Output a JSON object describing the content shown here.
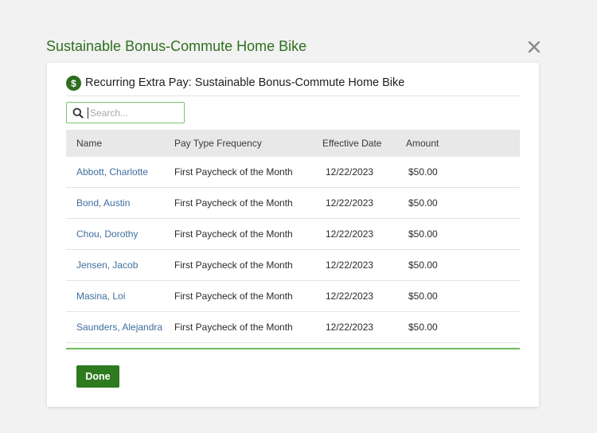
{
  "modal": {
    "title": "Sustainable Bonus-Commute Home Bike",
    "close_icon": "close-icon"
  },
  "card": {
    "icon": "dollar-icon",
    "icon_glyph": "$",
    "title": "Recurring Extra Pay: Sustainable Bonus-Commute Home Bike"
  },
  "search": {
    "icon": "search-icon",
    "placeholder": "Search...",
    "value": ""
  },
  "table": {
    "headers": {
      "name": "Name",
      "frequency": "Pay Type Frequency",
      "date": "Effective Date",
      "amount": "Amount"
    },
    "rows": [
      {
        "name": "Abbott, Charlotte",
        "frequency": "First Paycheck of the Month",
        "date": "12/22/2023",
        "amount": "$50.00"
      },
      {
        "name": "Bond, Austin",
        "frequency": "First Paycheck of the Month",
        "date": "12/22/2023",
        "amount": "$50.00"
      },
      {
        "name": "Chou, Dorothy",
        "frequency": "First Paycheck of the Month",
        "date": "12/22/2023",
        "amount": "$50.00"
      },
      {
        "name": "Jensen, Jacob",
        "frequency": "First Paycheck of the Month",
        "date": "12/22/2023",
        "amount": "$50.00"
      },
      {
        "name": "Masina, Loi",
        "frequency": "First Paycheck of the Month",
        "date": "12/22/2023",
        "amount": "$50.00"
      },
      {
        "name": "Saunders, Alejandra",
        "frequency": "First Paycheck of the Month",
        "date": "12/22/2023",
        "amount": "$50.00"
      }
    ]
  },
  "footer": {
    "done_label": "Done"
  },
  "colors": {
    "brand_green": "#2e7a1e",
    "title_green": "#2f6f1f",
    "accent_green": "#6dbb5a",
    "link_blue": "#3f6e9e"
  }
}
